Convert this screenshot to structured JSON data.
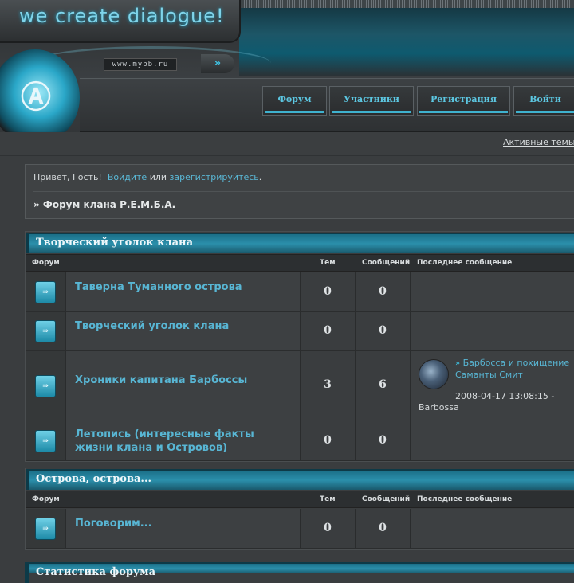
{
  "header": {
    "logo_text": "we create dialogue!",
    "url_text": "www.mybb.ru",
    "url_go": "»",
    "orb_icon": "Ⓐ"
  },
  "nav": {
    "items": [
      {
        "label": "Форум"
      },
      {
        "label": "Участники"
      },
      {
        "label": "Регистрация"
      },
      {
        "label": "Войти"
      }
    ]
  },
  "subbar": {
    "active_topics": "Активные темы"
  },
  "welcome": {
    "greeting": "Привет, Гость!",
    "login": "Войдите",
    "or": "или",
    "register": "зарегистрируйтесь",
    "period": ".",
    "breadcrumb": "» Форум клана Р.Е.М.Б.А."
  },
  "columns": {
    "forum": "Форум",
    "topics": "Тем",
    "posts": "Сообщений",
    "last": "Последнее сообщение"
  },
  "categories": [
    {
      "title": "Творческий уголок клана",
      "forums": [
        {
          "name": "Таверна Туманного острова",
          "topics": "0",
          "posts": "0"
        },
        {
          "name": "Творческий уголок клана",
          "topics": "0",
          "posts": "0"
        },
        {
          "name": "Хроники капитана Барбоссы",
          "topics": "3",
          "posts": "6",
          "last_title": "Барбосса и похищение Саманты Смит",
          "last_time": "2008-04-17 13:08:15 -",
          "last_user": "Barbossa"
        },
        {
          "name": "Летопись (интересные факты жизни клана и Островов)",
          "topics": "0",
          "posts": "0"
        }
      ]
    },
    {
      "title": "Острова, острова...",
      "forums": [
        {
          "name": "Поговорим...",
          "topics": "0",
          "posts": "0"
        }
      ]
    },
    {
      "title": "Статистика форума"
    }
  ],
  "icons": {
    "forum_icon": "forum-folder-icon",
    "new_post_icon": "double-arrow-icon"
  },
  "colors": {
    "accent": "#3ec3e4",
    "link": "#58b6d4",
    "category_bar": "#2b8fab"
  }
}
